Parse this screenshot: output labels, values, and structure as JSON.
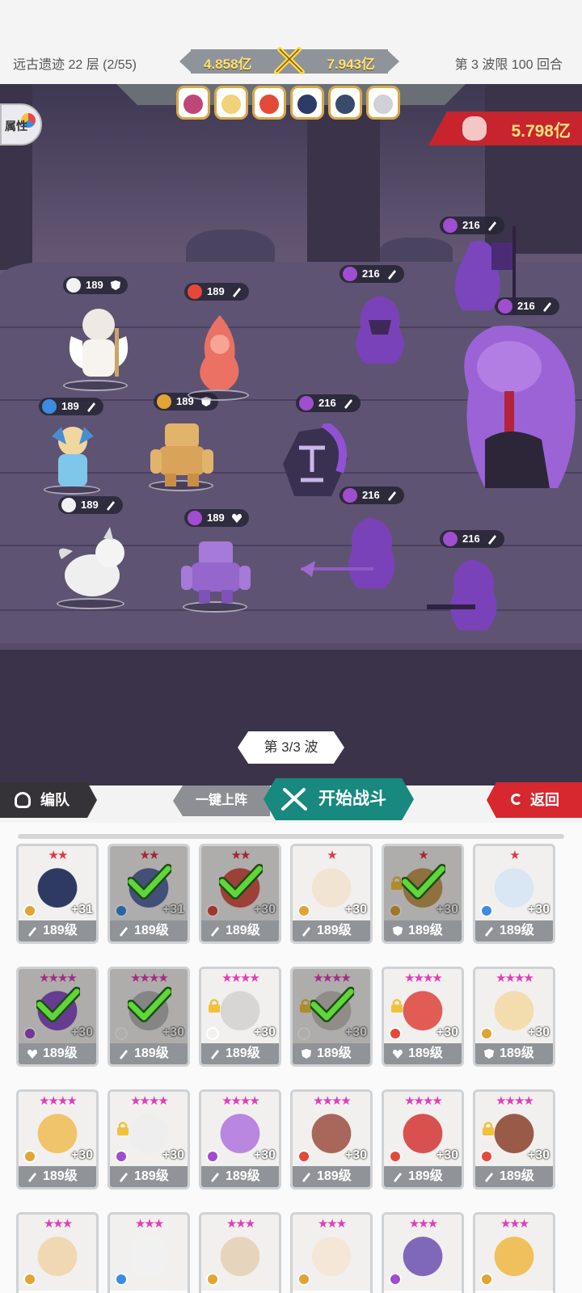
{
  "header": {
    "stage": "远古遗迹 22 层 (2/55)",
    "player_power": "4.858亿",
    "enemy_preview_power": "7.943亿",
    "wave_limit": "第 3 波限 100 回合"
  },
  "battle": {
    "attribute_button": "属性",
    "enemy_power": "5.798亿",
    "wave_indicator": "第 3/3 波",
    "allies": [
      {
        "level": "189",
        "element": "light",
        "role": "defense"
      },
      {
        "level": "189",
        "element": "fire",
        "role": "attack"
      },
      {
        "level": "189",
        "element": "water",
        "role": "attack"
      },
      {
        "level": "189",
        "element": "earth",
        "role": "defense"
      },
      {
        "level": "189",
        "element": "light",
        "role": "attack"
      },
      {
        "level": "189",
        "element": "dark",
        "role": "support"
      }
    ],
    "enemies": [
      {
        "level": "216",
        "element": "dark",
        "role": "attack"
      },
      {
        "level": "216",
        "element": "dark",
        "role": "attack"
      },
      {
        "level": "216",
        "element": "dark",
        "role": "attack"
      },
      {
        "level": "216",
        "element": "dark",
        "role": "attack"
      },
      {
        "level": "216",
        "element": "dark",
        "role": "attack"
      },
      {
        "level": "216",
        "element": "dark",
        "role": "attack"
      }
    ]
  },
  "actions": {
    "team": "编队",
    "one_click": "一键上阵",
    "start": "开始战斗",
    "return": "返回"
  },
  "colors": {
    "start_button": "#17897e",
    "return_button": "#d7272f",
    "enemy_banner": "#c7242e",
    "power_text": "#ffe27a"
  },
  "roster": [
    {
      "stars": "★★",
      "star_color": "#e8334a",
      "plus": "+31",
      "level": "189级",
      "element": "earth",
      "role": "attack",
      "selected": false,
      "locked": false,
      "art": "#2f3a63"
    },
    {
      "stars": "★★",
      "star_color": "#e8334a",
      "plus": "+31",
      "level": "189级",
      "element": "water",
      "role": "attack",
      "selected": true,
      "locked": false,
      "art": "#5b6ea8"
    },
    {
      "stars": "★★",
      "star_color": "#e8334a",
      "plus": "+30",
      "level": "189级",
      "element": "fire",
      "role": "attack",
      "selected": true,
      "locked": false,
      "art": "#d85a4e"
    },
    {
      "stars": "★",
      "star_color": "#e8334a",
      "plus": "+30",
      "level": "189级",
      "element": "earth",
      "role": "attack",
      "selected": false,
      "locked": false,
      "art": "#f1e4d2"
    },
    {
      "stars": "★",
      "star_color": "#e8334a",
      "plus": "+30",
      "level": "189级",
      "element": "earth",
      "role": "defense",
      "selected": true,
      "locked": true,
      "art": "#c69c58"
    },
    {
      "stars": "★",
      "star_color": "#e8334a",
      "plus": "+30",
      "level": "189级",
      "element": "water",
      "role": "attack",
      "selected": false,
      "locked": false,
      "art": "#d9e6f3"
    },
    {
      "stars": "★★★★",
      "star_color": "#e23db8",
      "plus": "+30",
      "level": "189级",
      "element": "dark",
      "role": "support",
      "selected": true,
      "locked": false,
      "art": "#8e52c9"
    },
    {
      "stars": "★★★★",
      "star_color": "#e23db8",
      "plus": "+30",
      "level": "189级",
      "element": "light",
      "role": "attack",
      "selected": true,
      "locked": false,
      "art": "#b9b9b9"
    },
    {
      "stars": "★★★★",
      "star_color": "#e23db8",
      "plus": "+30",
      "level": "189级",
      "element": "light",
      "role": "attack",
      "selected": false,
      "locked": true,
      "art": "#d8d6d4"
    },
    {
      "stars": "★★★★",
      "star_color": "#e23db8",
      "plus": "+30",
      "level": "189级",
      "element": "light",
      "role": "defense",
      "selected": true,
      "locked": true,
      "art": "#c8c3bd"
    },
    {
      "stars": "★★★★",
      "star_color": "#e23db8",
      "plus": "+30",
      "level": "189级",
      "element": "fire",
      "role": "support",
      "selected": false,
      "locked": true,
      "art": "#e05c55"
    },
    {
      "stars": "★★★★",
      "star_color": "#e23db8",
      "plus": "+30",
      "level": "189级",
      "element": "earth",
      "role": "defense",
      "selected": false,
      "locked": false,
      "art": "#f3dcae"
    },
    {
      "stars": "★★★★",
      "star_color": "#e23db8",
      "plus": "+30",
      "level": "189级",
      "element": "earth",
      "role": "attack",
      "selected": false,
      "locked": false,
      "art": "#f0c46a"
    },
    {
      "stars": "★★★★",
      "star_color": "#e23db8",
      "plus": "+30",
      "level": "189级",
      "element": "dark",
      "role": "attack",
      "selected": false,
      "locked": true,
      "art": "#eeeeee"
    },
    {
      "stars": "★★★★",
      "star_color": "#e23db8",
      "plus": "+30",
      "level": "189级",
      "element": "dark",
      "role": "attack",
      "selected": false,
      "locked": false,
      "art": "#b986e0"
    },
    {
      "stars": "★★★★",
      "star_color": "#e23db8",
      "plus": "+30",
      "level": "189级",
      "element": "fire",
      "role": "attack",
      "selected": false,
      "locked": false,
      "art": "#a9665a"
    },
    {
      "stars": "★★★★",
      "star_color": "#e23db8",
      "plus": "+30",
      "level": "189级",
      "element": "fire",
      "role": "attack",
      "selected": false,
      "locked": false,
      "art": "#d8504f"
    },
    {
      "stars": "★★★★",
      "star_color": "#e23db8",
      "plus": "+30",
      "level": "189级",
      "element": "fire",
      "role": "attack",
      "selected": false,
      "locked": true,
      "art": "#9a5a48"
    },
    {
      "stars": "★★★",
      "star_color": "#e23db8",
      "plus": "",
      "level": "",
      "element": "earth",
      "role": "attack",
      "selected": false,
      "locked": false,
      "art": "#efd8b2"
    },
    {
      "stars": "★★★",
      "star_color": "#e23db8",
      "plus": "",
      "level": "",
      "element": "water",
      "role": "attack",
      "selected": false,
      "locked": false,
      "art": "#f1f1f1"
    },
    {
      "stars": "★★★",
      "star_color": "#e23db8",
      "plus": "",
      "level": "",
      "element": "earth",
      "role": "attack",
      "selected": false,
      "locked": false,
      "art": "#e7d4bc"
    },
    {
      "stars": "★★★",
      "star_color": "#e23db8",
      "plus": "",
      "level": "",
      "element": "earth",
      "role": "attack",
      "selected": false,
      "locked": false,
      "art": "#f4e7d7"
    },
    {
      "stars": "★★★",
      "star_color": "#e23db8",
      "plus": "",
      "level": "",
      "element": "dark",
      "role": "attack",
      "selected": false,
      "locked": false,
      "art": "#7f68b9"
    },
    {
      "stars": "★★★",
      "star_color": "#e23db8",
      "plus": "",
      "level": "",
      "element": "earth",
      "role": "attack",
      "selected": false,
      "locked": false,
      "art": "#f0c05c"
    }
  ]
}
